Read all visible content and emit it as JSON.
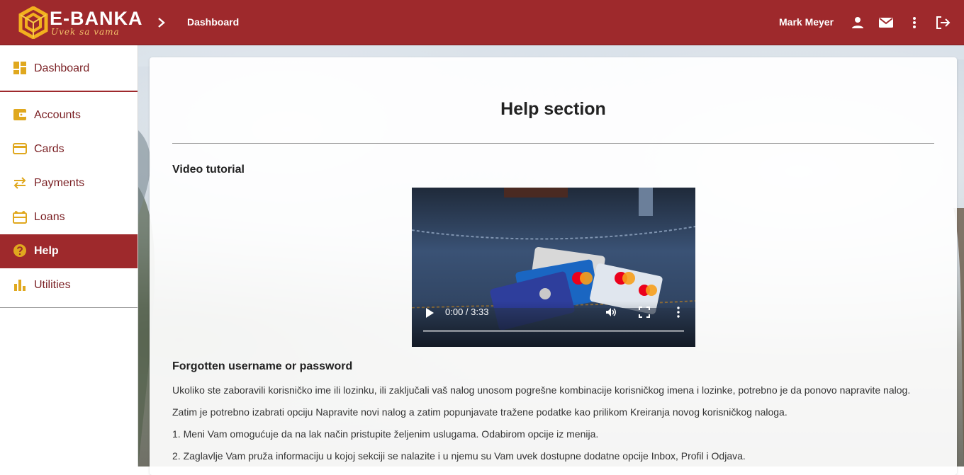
{
  "header": {
    "brand": "E-BANKA",
    "tagline": "Uvek sa vama",
    "breadcrumb": "Dashboard",
    "user_name": "Mark Meyer",
    "icons": [
      "user-icon",
      "mail-icon",
      "more-vert-icon",
      "logout-icon"
    ],
    "color": "#9e292c"
  },
  "sidebar": {
    "items": [
      {
        "label": "Dashboard",
        "icon": "dashboard-icon"
      },
      {
        "label": "Accounts",
        "icon": "wallet-icon"
      },
      {
        "label": "Cards",
        "icon": "credit-card-icon"
      },
      {
        "label": "Payments",
        "icon": "swap-arrows-icon"
      },
      {
        "label": "Loans",
        "icon": "gift-card-icon"
      },
      {
        "label": "Help",
        "icon": "help-circle-icon",
        "active": true
      },
      {
        "label": "Utilities",
        "icon": "bar-chart-icon"
      }
    ],
    "accent_color": "#e0a81e"
  },
  "main": {
    "title": "Help section",
    "video_heading": "Video tutorial",
    "video": {
      "time": "0:00 / 3:33",
      "progress": 0
    },
    "forgot_heading": "Forgotten username or password",
    "paragraphs": [
      "Ukoliko ste zaboravili korisničko ime ili lozinku, ili zaključali vaš nalog unosom pogrešne kombinacije korisničkog imena i lozinke, potrebno je da ponovo napravite nalog.",
      "Zatim je potrebno izabrati opciju Napravite novi nalog a zatim popunjavate tražene podatke kao prilikom Kreiranja novog korisničkog naloga.",
      "1. Meni Vam omogućuje da na lak način pristupite željenim uslugama. Odabirom opcije iz menija.",
      "2. Zaglavlje Vam pruža informaciju u kojoj sekciji se nalazite i u njemu su Vam uvek dostupne dodatne opcije Inbox, Profil i Odjava."
    ]
  }
}
